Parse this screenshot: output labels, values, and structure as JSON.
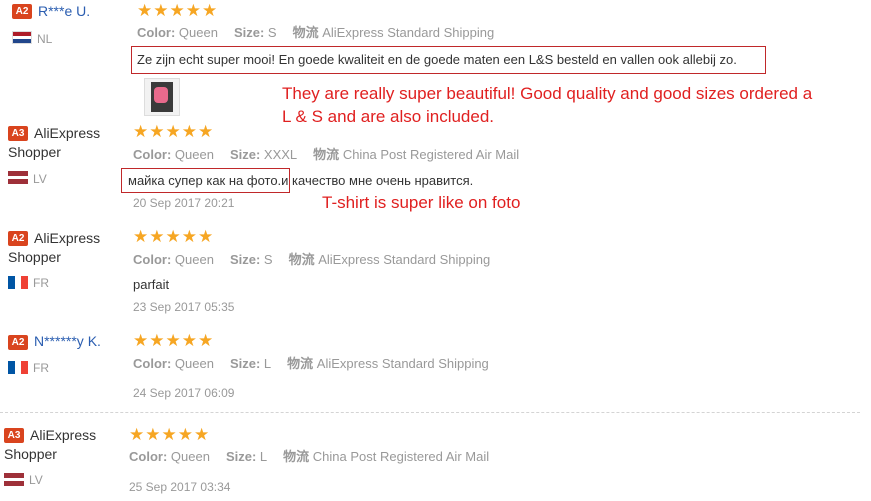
{
  "labels": {
    "color": "Color:",
    "size": "Size:",
    "shipping": "物流"
  },
  "reviews": [
    {
      "badge": "A2",
      "name": "R***e U.",
      "country": "NL",
      "color": "Queen",
      "size": "S",
      "shipping": "AliExpress Standard Shipping",
      "text": "Ze zijn echt super mooi! En goede kwaliteit en de goede maten een L&S besteld en vallen ook allebij zo.",
      "translation_line1": "They are really super beautiful! Good quality and good sizes ordered a",
      "translation_line2": "L & S and are also included.",
      "stars": 5
    },
    {
      "badge": "A3",
      "name_line1": "AliExpress",
      "name_line2": "Shopper",
      "country": "LV",
      "color": "Queen",
      "size": "XXXL",
      "shipping": "China Post Registered Air Mail",
      "text": "майка супер как на фото.и качество мне очень нравится.",
      "date": "20 Sep 2017 20:21",
      "translation": "T-shirt is super like on foto",
      "stars": 5
    },
    {
      "badge": "A2",
      "name_line1": "AliExpress",
      "name_line2": "Shopper",
      "country": "FR",
      "color": "Queen",
      "size": "S",
      "shipping": "AliExpress Standard Shipping",
      "text": "parfait",
      "date": "23 Sep 2017 05:35",
      "stars": 5
    },
    {
      "badge": "A2",
      "name": "N******y K.",
      "country": "FR",
      "color": "Queen",
      "size": "L",
      "shipping": "AliExpress Standard Shipping",
      "date": "24 Sep 2017 06:09",
      "stars": 5
    },
    {
      "badge": "A3",
      "name_line1": "AliExpress",
      "name_line2": "Shopper",
      "country": "LV",
      "color": "Queen",
      "size": "L",
      "shipping": "China Post Registered Air Mail",
      "date": "25 Sep 2017 03:34",
      "stars": 5
    }
  ],
  "colors": {
    "badge": "#d9441e",
    "star": "#f6a623",
    "annotation": "#e02020",
    "link": "#2a5db0"
  }
}
